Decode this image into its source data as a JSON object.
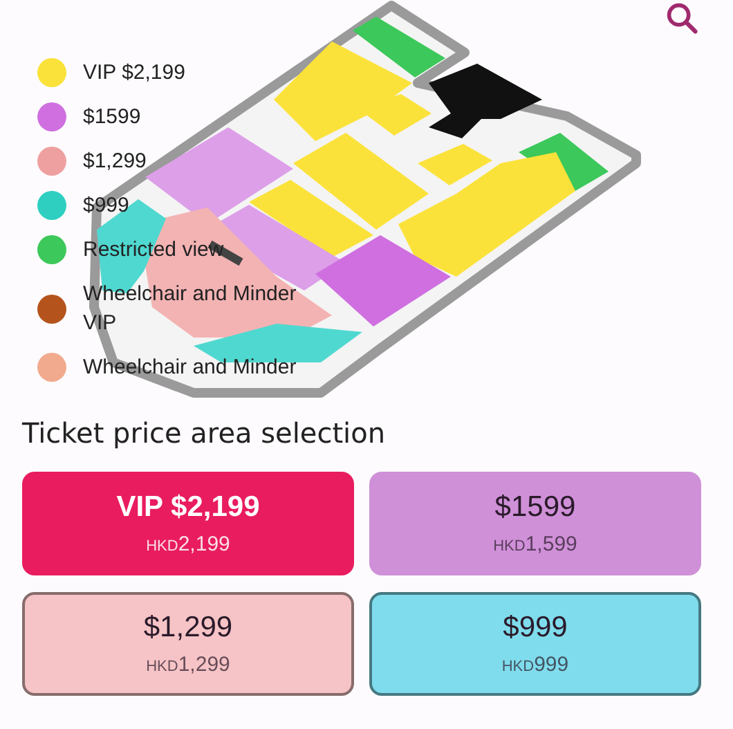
{
  "legend": [
    {
      "label": "VIP $2,199",
      "color": "#fbe23a"
    },
    {
      "label": "$1599",
      "color": "#cf6fe0"
    },
    {
      "label": "$1,299",
      "color": "#eea0a0"
    },
    {
      "label": "$999",
      "color": "#2ecfc0"
    },
    {
      "label": "Restricted view",
      "color": "#3cc85a"
    },
    {
      "label": "Wheelchair and Minder VIP",
      "color": "#b5531c"
    },
    {
      "label": "Wheelchair and Minder",
      "color": "#f2aa8e"
    }
  ],
  "section_title": "Ticket price area selection",
  "price_options": [
    {
      "label": "VIP $2,199",
      "currency": "HKD",
      "amount": "2,199",
      "selected": true,
      "bordered": false,
      "color": "#e91c5f"
    },
    {
      "label": "$1599",
      "currency": "HKD",
      "amount": "1,599",
      "selected": false,
      "bordered": false,
      "color": "#cf90d8"
    },
    {
      "label": "$1,299",
      "currency": "HKD",
      "amount": "1,299",
      "selected": false,
      "bordered": true,
      "color": "#f6c4c6"
    },
    {
      "label": "$999",
      "currency": "HKD",
      "amount": "999",
      "selected": false,
      "bordered": true,
      "color": "#7fdcec"
    }
  ]
}
